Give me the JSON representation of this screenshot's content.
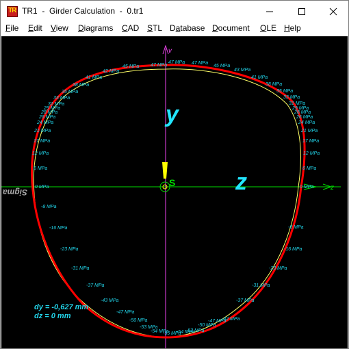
{
  "window": {
    "icon_text": "TR",
    "title": "TR1  -  Girder Calculation  -  0.tr1"
  },
  "menu": [
    {
      "label": "File",
      "accel": "F"
    },
    {
      "label": "Edit",
      "accel": "E"
    },
    {
      "label": "View",
      "accel": "V"
    },
    {
      "label": "Diagrams",
      "accel": "D"
    },
    {
      "label": "CAD",
      "accel": "C"
    },
    {
      "label": "STL",
      "accel": "S"
    },
    {
      "label": "Database",
      "accel": "a"
    },
    {
      "label": "Document",
      "accel": "D"
    },
    {
      "label": "OLE",
      "accel": "O"
    },
    {
      "label": "Help",
      "accel": "H"
    }
  ],
  "drawing": {
    "axis_y_label": "y",
    "axis_z_label": "z",
    "axis_v_label": "v",
    "axis_z_small_label": "z",
    "shear_center_label": "S",
    "sigma_label": "Sigma",
    "dy": "dy = -0,627 mm",
    "dz": "dz = 0 mm",
    "colors": {
      "background": "#000000",
      "contour": "#ff0000",
      "stress_line": "#ffff66",
      "axis_h": "#00dd00",
      "axis_v": "#ee44ee",
      "labels": "#22d3e8",
      "axis_letters": "#22e5ff",
      "marker": "#ffff00"
    },
    "stress_labels_left": [
      "45 MPa",
      "42 MPa",
      "41 MPa",
      "38 MPa",
      "35 MPa",
      "33 MPa",
      "31 MPa",
      "29 MPa",
      "28 MPa",
      "26 MPa",
      "24 MPa",
      "21 MPa",
      "17 MPa",
      "12 MPa",
      "6 MPa",
      "0 MPa",
      "-8 MPa",
      "-16 MPa",
      "-23 MPa",
      "-31 MPa",
      "-37 MPa",
      "-43 MPa",
      "-47 MPa",
      "-50 MPa",
      "-53 MPa",
      "-54 MPa",
      "-55 MPa"
    ],
    "stress_labels_right": [
      "47 MPa",
      "45 MPa",
      "43 MPa",
      "41 MPa",
      "38 MPa",
      "35 MPa",
      "33 MPa",
      "31 MPa",
      "29 MPa",
      "28 MPa",
      "26 MPa",
      "24 MPa",
      "21 MPa",
      "17 MPa",
      "12 MPa",
      "6 MPa",
      "0 MPa",
      "-8 MPa",
      "-16 MPa",
      "-23 MPa",
      "-31 MPa",
      "-37 MPa",
      "-42 MPa",
      "-47 MPa",
      "-50 MPa",
      "-53 MPa",
      "-54 MPa",
      "-55 MPa"
    ],
    "stress_labels_top": [
      "47 MPa",
      "47 MPa",
      "47 MPa"
    ]
  }
}
